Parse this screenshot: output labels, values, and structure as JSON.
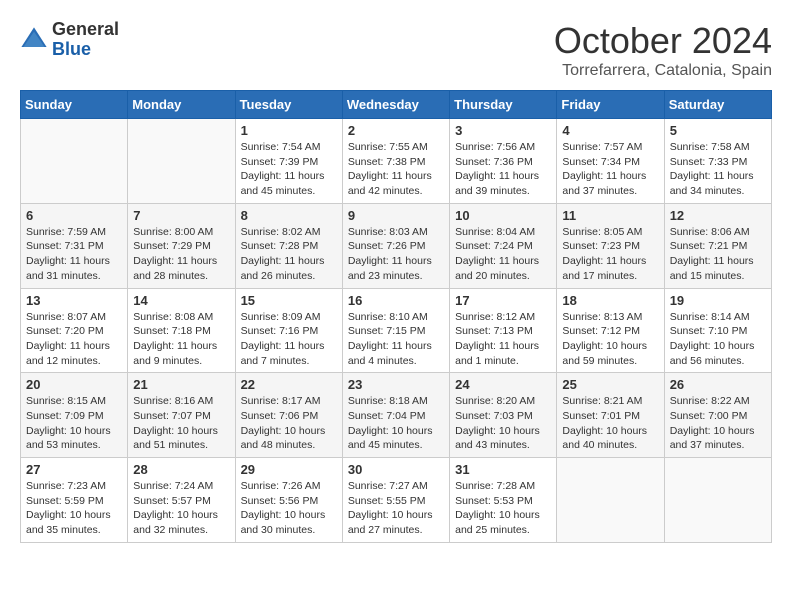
{
  "logo": {
    "general": "General",
    "blue": "Blue"
  },
  "title": "October 2024",
  "subtitle": "Torrefarrera, Catalonia, Spain",
  "days_of_week": [
    "Sunday",
    "Monday",
    "Tuesday",
    "Wednesday",
    "Thursday",
    "Friday",
    "Saturday"
  ],
  "weeks": [
    [
      {
        "day": "",
        "content": ""
      },
      {
        "day": "",
        "content": ""
      },
      {
        "day": "1",
        "content": "Sunrise: 7:54 AM\nSunset: 7:39 PM\nDaylight: 11 hours and 45 minutes."
      },
      {
        "day": "2",
        "content": "Sunrise: 7:55 AM\nSunset: 7:38 PM\nDaylight: 11 hours and 42 minutes."
      },
      {
        "day": "3",
        "content": "Sunrise: 7:56 AM\nSunset: 7:36 PM\nDaylight: 11 hours and 39 minutes."
      },
      {
        "day": "4",
        "content": "Sunrise: 7:57 AM\nSunset: 7:34 PM\nDaylight: 11 hours and 37 minutes."
      },
      {
        "day": "5",
        "content": "Sunrise: 7:58 AM\nSunset: 7:33 PM\nDaylight: 11 hours and 34 minutes."
      }
    ],
    [
      {
        "day": "6",
        "content": "Sunrise: 7:59 AM\nSunset: 7:31 PM\nDaylight: 11 hours and 31 minutes."
      },
      {
        "day": "7",
        "content": "Sunrise: 8:00 AM\nSunset: 7:29 PM\nDaylight: 11 hours and 28 minutes."
      },
      {
        "day": "8",
        "content": "Sunrise: 8:02 AM\nSunset: 7:28 PM\nDaylight: 11 hours and 26 minutes."
      },
      {
        "day": "9",
        "content": "Sunrise: 8:03 AM\nSunset: 7:26 PM\nDaylight: 11 hours and 23 minutes."
      },
      {
        "day": "10",
        "content": "Sunrise: 8:04 AM\nSunset: 7:24 PM\nDaylight: 11 hours and 20 minutes."
      },
      {
        "day": "11",
        "content": "Sunrise: 8:05 AM\nSunset: 7:23 PM\nDaylight: 11 hours and 17 minutes."
      },
      {
        "day": "12",
        "content": "Sunrise: 8:06 AM\nSunset: 7:21 PM\nDaylight: 11 hours and 15 minutes."
      }
    ],
    [
      {
        "day": "13",
        "content": "Sunrise: 8:07 AM\nSunset: 7:20 PM\nDaylight: 11 hours and 12 minutes."
      },
      {
        "day": "14",
        "content": "Sunrise: 8:08 AM\nSunset: 7:18 PM\nDaylight: 11 hours and 9 minutes."
      },
      {
        "day": "15",
        "content": "Sunrise: 8:09 AM\nSunset: 7:16 PM\nDaylight: 11 hours and 7 minutes."
      },
      {
        "day": "16",
        "content": "Sunrise: 8:10 AM\nSunset: 7:15 PM\nDaylight: 11 hours and 4 minutes."
      },
      {
        "day": "17",
        "content": "Sunrise: 8:12 AM\nSunset: 7:13 PM\nDaylight: 11 hours and 1 minute."
      },
      {
        "day": "18",
        "content": "Sunrise: 8:13 AM\nSunset: 7:12 PM\nDaylight: 10 hours and 59 minutes."
      },
      {
        "day": "19",
        "content": "Sunrise: 8:14 AM\nSunset: 7:10 PM\nDaylight: 10 hours and 56 minutes."
      }
    ],
    [
      {
        "day": "20",
        "content": "Sunrise: 8:15 AM\nSunset: 7:09 PM\nDaylight: 10 hours and 53 minutes."
      },
      {
        "day": "21",
        "content": "Sunrise: 8:16 AM\nSunset: 7:07 PM\nDaylight: 10 hours and 51 minutes."
      },
      {
        "day": "22",
        "content": "Sunrise: 8:17 AM\nSunset: 7:06 PM\nDaylight: 10 hours and 48 minutes."
      },
      {
        "day": "23",
        "content": "Sunrise: 8:18 AM\nSunset: 7:04 PM\nDaylight: 10 hours and 45 minutes."
      },
      {
        "day": "24",
        "content": "Sunrise: 8:20 AM\nSunset: 7:03 PM\nDaylight: 10 hours and 43 minutes."
      },
      {
        "day": "25",
        "content": "Sunrise: 8:21 AM\nSunset: 7:01 PM\nDaylight: 10 hours and 40 minutes."
      },
      {
        "day": "26",
        "content": "Sunrise: 8:22 AM\nSunset: 7:00 PM\nDaylight: 10 hours and 37 minutes."
      }
    ],
    [
      {
        "day": "27",
        "content": "Sunrise: 7:23 AM\nSunset: 5:59 PM\nDaylight: 10 hours and 35 minutes."
      },
      {
        "day": "28",
        "content": "Sunrise: 7:24 AM\nSunset: 5:57 PM\nDaylight: 10 hours and 32 minutes."
      },
      {
        "day": "29",
        "content": "Sunrise: 7:26 AM\nSunset: 5:56 PM\nDaylight: 10 hours and 30 minutes."
      },
      {
        "day": "30",
        "content": "Sunrise: 7:27 AM\nSunset: 5:55 PM\nDaylight: 10 hours and 27 minutes."
      },
      {
        "day": "31",
        "content": "Sunrise: 7:28 AM\nSunset: 5:53 PM\nDaylight: 10 hours and 25 minutes."
      },
      {
        "day": "",
        "content": ""
      },
      {
        "day": "",
        "content": ""
      }
    ]
  ]
}
